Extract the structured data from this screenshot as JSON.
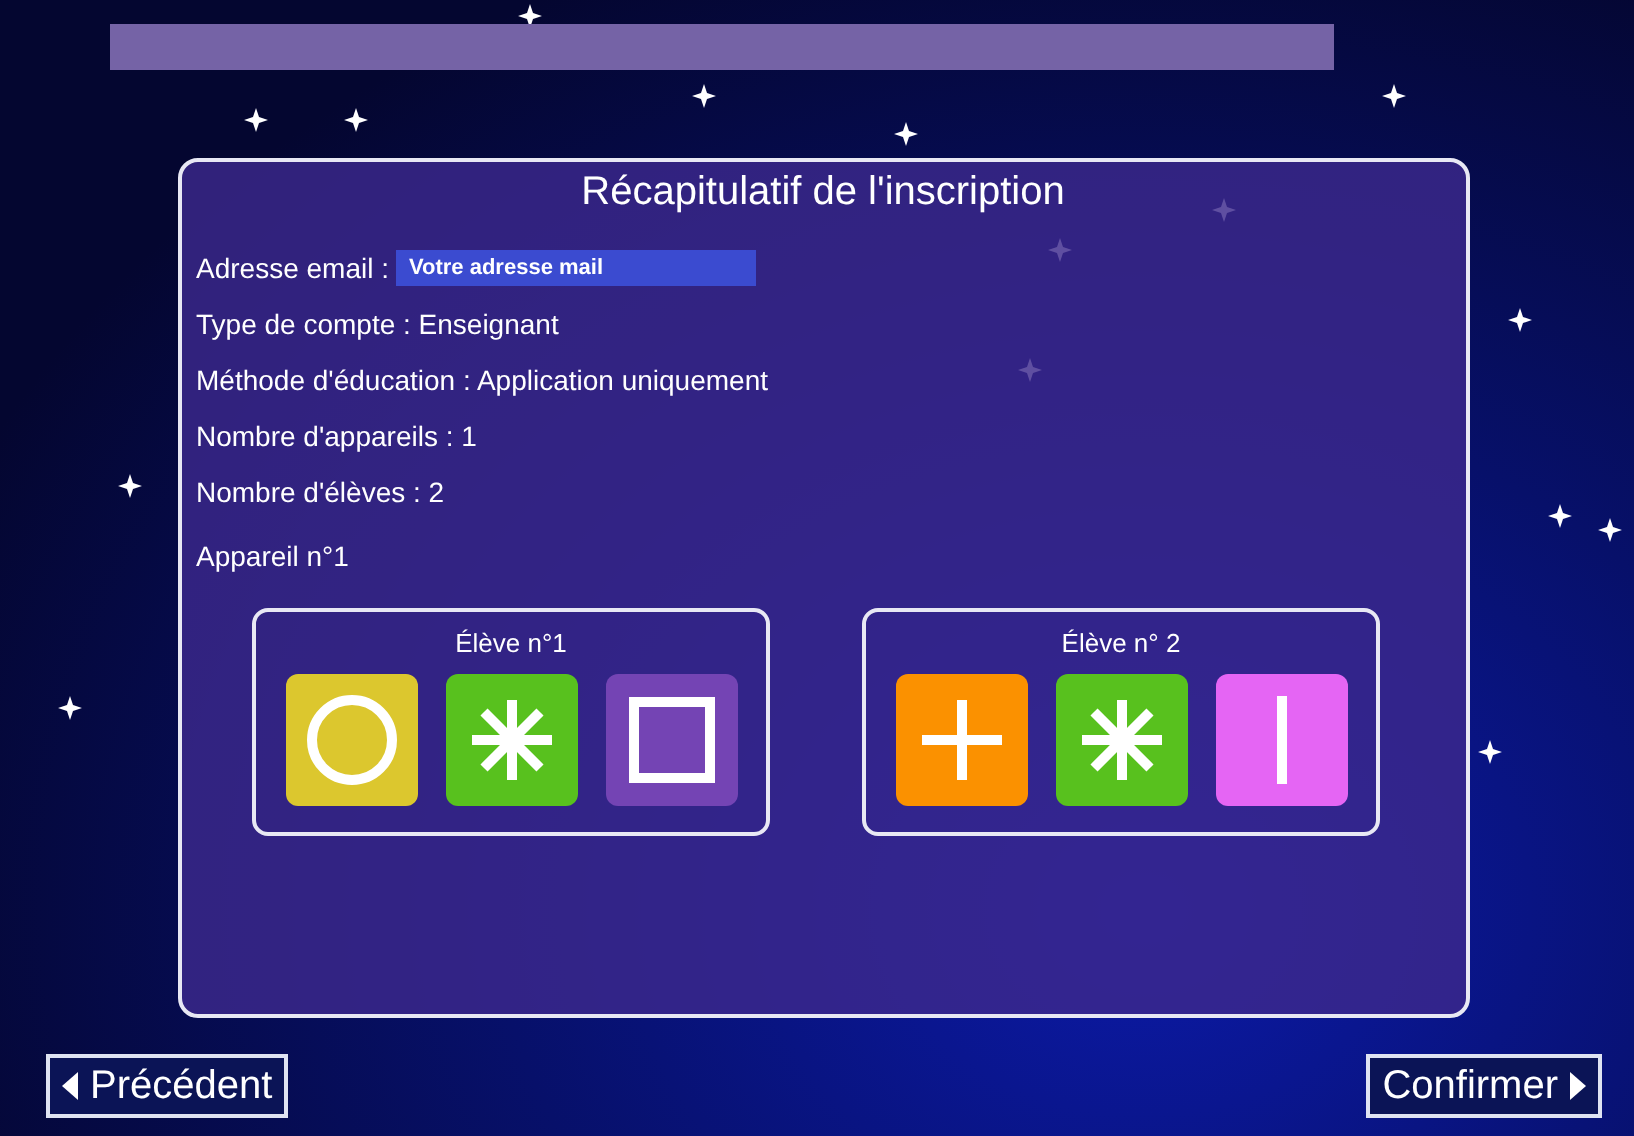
{
  "title": "Récapitulatif de l'inscription",
  "email": {
    "label": "Adresse email :",
    "placeholder": "Votre adresse mail"
  },
  "details": [
    "Type de compte : Enseignant",
    "Méthode d'éducation : Application uniquement",
    "Nombre d'appareils : 1",
    "Nombre d'élèves : 2"
  ],
  "device": "Appareil n°1",
  "students": [
    {
      "label": "Élève n°1",
      "symbols": [
        {
          "kind": "circle",
          "color": "#dcc72e"
        },
        {
          "kind": "asterisk",
          "color": "#58c11e"
        },
        {
          "kind": "square",
          "color": "#7444b4"
        }
      ]
    },
    {
      "label": "Élève n° 2",
      "symbols": [
        {
          "kind": "plus",
          "color": "#fb9100"
        },
        {
          "kind": "asterisk",
          "color": "#58c11e"
        },
        {
          "kind": "bar",
          "color": "#e565f4"
        }
      ]
    }
  ],
  "buttons": {
    "previous": "Précédent",
    "confirm": "Confirmer"
  }
}
